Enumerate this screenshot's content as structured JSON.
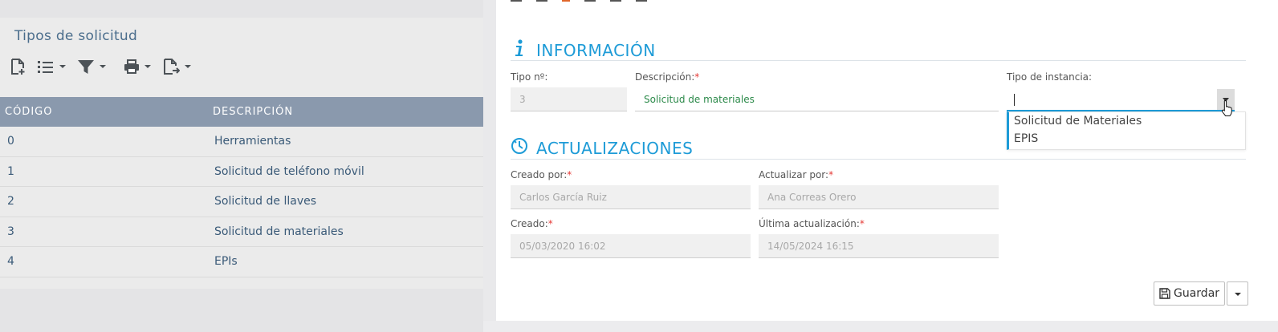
{
  "list": {
    "title": "Tipos de solicitud",
    "columns": [
      "CÓDIGO",
      "DESCRIPCIÓN"
    ],
    "rows": [
      {
        "codigo": "0",
        "descripcion": "Herramientas"
      },
      {
        "codigo": "1",
        "descripcion": "Solicitud de teléfono móvil"
      },
      {
        "codigo": "2",
        "descripcion": "Solicitud de llaves"
      },
      {
        "codigo": "3",
        "descripcion": "Solicitud de materiales"
      },
      {
        "codigo": "4",
        "descripcion": "EPIs"
      }
    ]
  },
  "form": {
    "info_section": "INFORMACIÓN",
    "tipo_label": "Tipo nº:",
    "tipo_value": "3",
    "descripcion_label": "Descripción:",
    "descripcion_value": "Solicitud de materiales",
    "instancia_label": "Tipo de instancia:",
    "instancia_value": "",
    "instancia_options": [
      "Solicitud de Materiales",
      "EPIS"
    ],
    "updates_section": "ACTUALIZACIONES",
    "creado_por_label": "Creado por:",
    "creado_por_value": "Carlos García Ruiz",
    "actualizar_por_label": "Actualizar por:",
    "actualizar_por_value": "Ana  Correas Orero",
    "creado_label": "Creado:",
    "creado_value": "05/03/2020 16:02",
    "ultima_label": "Última actualización:",
    "ultima_value": "14/05/2024 16:15",
    "required_mark": "*",
    "save_label": "Guardar"
  },
  "icons": [
    "new-document-icon",
    "list-icon",
    "filter-icon",
    "print-icon",
    "export-icon",
    "info-icon",
    "clock-icon",
    "save-icon",
    "hand-cursor-icon"
  ],
  "colors": {
    "accent": "#1d9bd7",
    "table_header": "#8a99ad",
    "required": "#e53935",
    "edit_text": "#2c8a4a"
  }
}
